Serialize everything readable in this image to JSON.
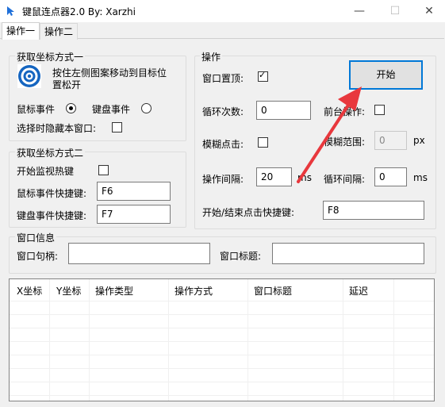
{
  "window": {
    "title": "键鼠连点器2.0 By:  Xarzhi",
    "minimize": "—",
    "maximize": "☐",
    "close": "✕"
  },
  "tabs": [
    "操作一",
    "操作二"
  ],
  "group1": {
    "legend": "获取坐标方式一",
    "instruction_line1": "按住左侧图案移动到目标位",
    "instruction_line2": "置松开",
    "mouse_event_label": "鼠标事件",
    "keyboard_event_label": "键盘事件",
    "mouse_event_selected": true,
    "keyboard_event_selected": false,
    "hide_window_label": "选择时隐藏本窗口:",
    "hide_window_checked": false
  },
  "group2": {
    "legend": "获取坐标方式二",
    "monitor_hotkey_label": "开始监视热键",
    "monitor_hotkey_checked": false,
    "mouse_hotkey_label": "鼠标事件快捷键:",
    "mouse_hotkey_value": "F6",
    "keyboard_hotkey_label": "键盘事件快捷键:",
    "keyboard_hotkey_value": "F7"
  },
  "operation": {
    "legend": "操作",
    "topmost_label": "窗口置顶:",
    "topmost_checked": true,
    "start_button": "开始",
    "loop_count_label": "循环次数:",
    "loop_count_value": "0",
    "foreground_label": "前台操作:",
    "foreground_checked": false,
    "fuzzy_click_label": "模糊点击:",
    "fuzzy_click_checked": false,
    "fuzzy_range_label": "模糊范围:",
    "fuzzy_range_value": "0",
    "fuzzy_range_unit": "px",
    "interval_label": "操作间隔:",
    "interval_value": "20",
    "interval_unit": "ms",
    "loop_interval_label": "循环间隔:",
    "loop_interval_value": "0",
    "loop_interval_unit": "ms",
    "start_stop_hotkey_label": "开始/结束点击快捷键:",
    "start_stop_hotkey_value": "F8"
  },
  "window_info": {
    "legend": "窗口信息",
    "handle_label": "窗口句柄:",
    "handle_value": "",
    "title_label": "窗口标题:",
    "title_value": ""
  },
  "table": {
    "columns": [
      "X坐标",
      "Y坐标",
      "操作类型",
      "操作方式",
      "窗口标题",
      "延迟"
    ],
    "rows": []
  },
  "colors": {
    "accent": "#0078d7",
    "arrow": "#e8383d",
    "target_icon": "#1565c0"
  }
}
